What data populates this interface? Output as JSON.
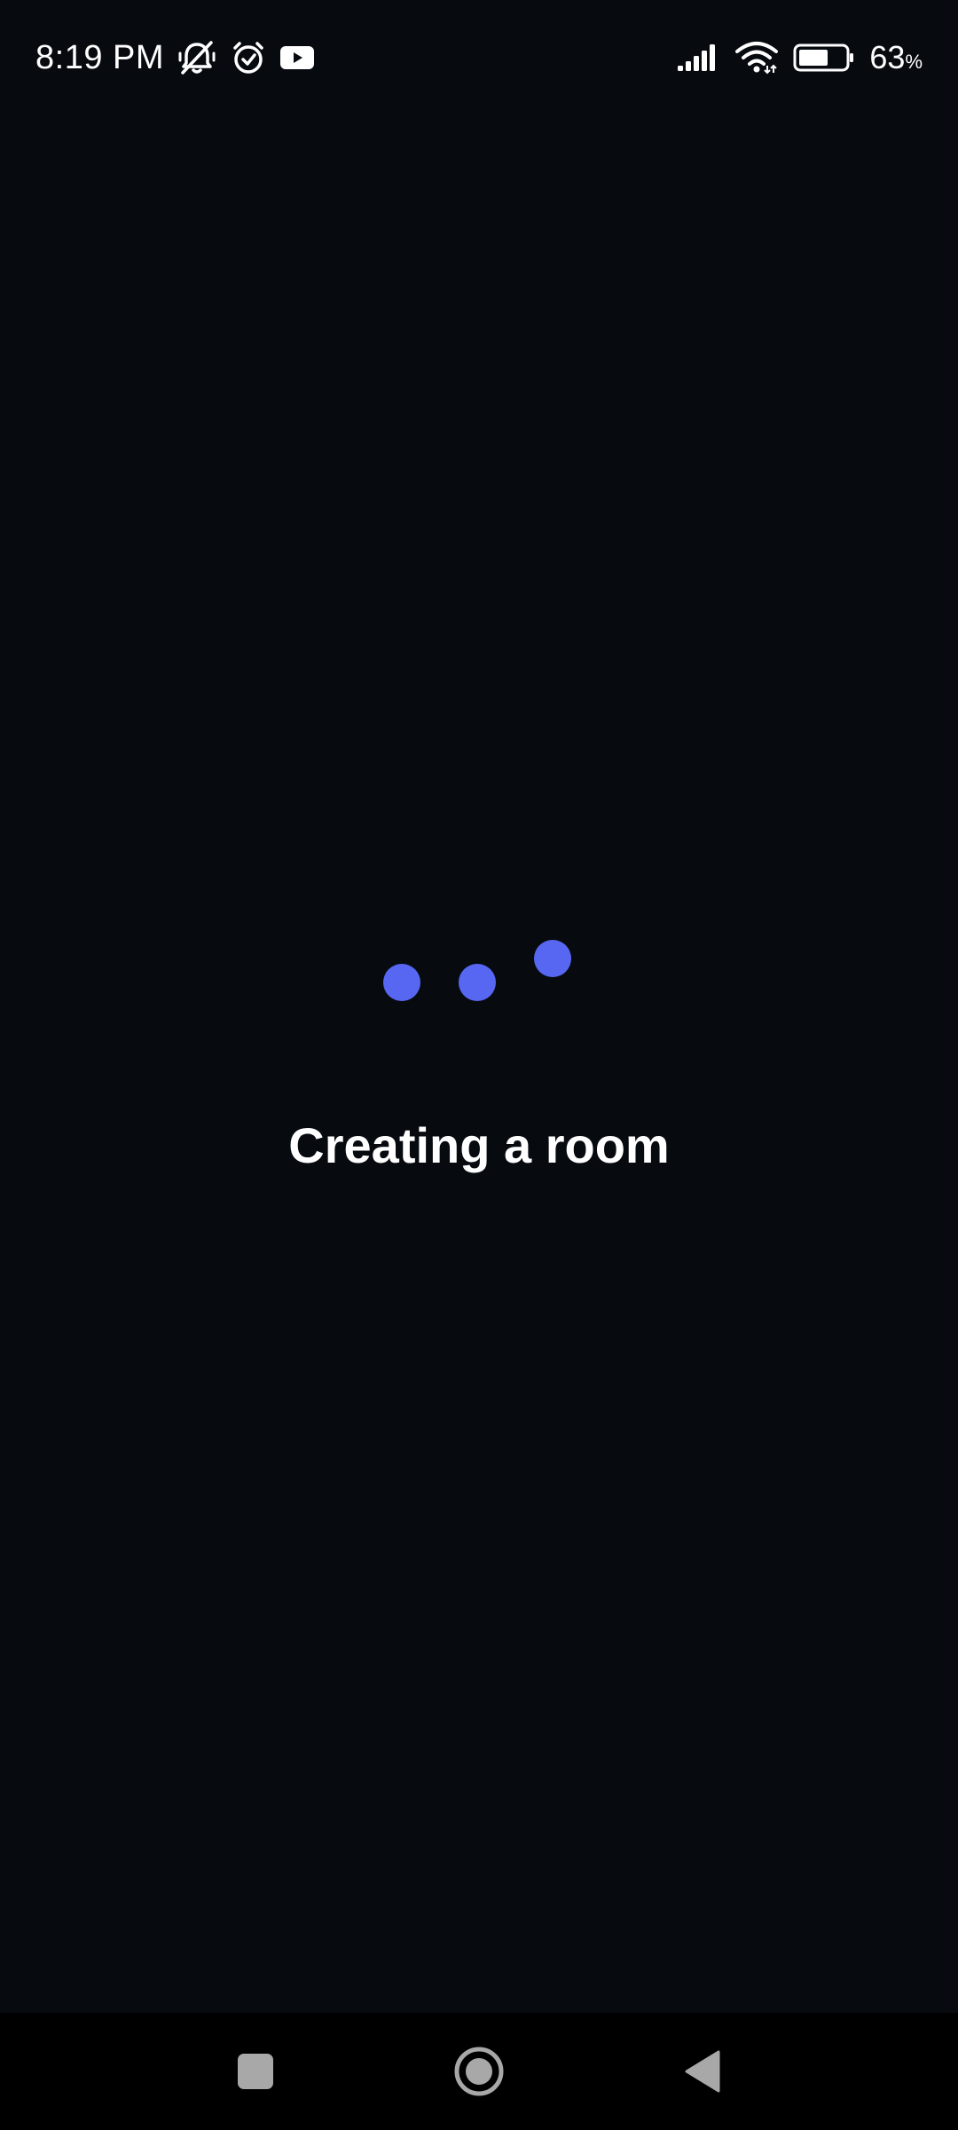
{
  "status_bar": {
    "time": "8:19 PM",
    "battery_percent": "63",
    "battery_percent_sign": "%",
    "battery_level": 0.63,
    "icons": [
      "bell-off-icon",
      "alarm-icon",
      "youtube-icon",
      "signal-icon",
      "wifi-icon",
      "battery-icon"
    ]
  },
  "main": {
    "message": "Creating a room",
    "loader_color": "#5867f2",
    "background_color": "#070b10"
  },
  "nav_bar": {
    "buttons": [
      "recents",
      "home",
      "back"
    ]
  }
}
